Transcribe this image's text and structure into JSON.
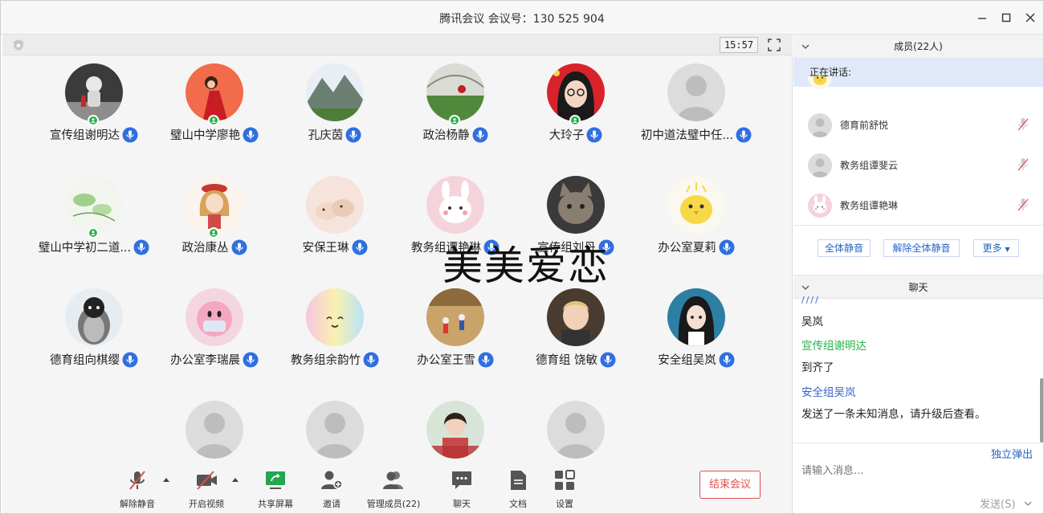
{
  "window": {
    "title": "腾讯会议 会议号：130 525 904"
  },
  "stage": {
    "timer": "15:57",
    "watermark": "美美爱恋"
  },
  "participants": [
    {
      "name": "宣传组谢明达",
      "avatar": "astronaut-photo",
      "host": true
    },
    {
      "name": "璧山中学廖艳",
      "avatar": "girl-red-dress",
      "host": true
    },
    {
      "name": "孔庆茵",
      "avatar": "mountain-landscape",
      "host": false
    },
    {
      "name": "政治杨静",
      "avatar": "greenhouse-photo",
      "host": true
    },
    {
      "name": "大玲子",
      "avatar": "cartoon-girl-glasses",
      "host": true
    },
    {
      "name": "初中道法璧中任...",
      "avatar": "default-person",
      "host": false
    },
    {
      "name": "璧山中学初二道...",
      "avatar": "green-illustration",
      "host": true
    },
    {
      "name": "政治康丛",
      "avatar": "cartoon-girl-beret",
      "host": true
    },
    {
      "name": "安保王琳",
      "avatar": "hamsters",
      "host": false
    },
    {
      "name": "教务组谭艳琳",
      "avatar": "pink-rabbit",
      "host": false
    },
    {
      "name": "宣传组刘丹",
      "avatar": "cat-photo",
      "host": false
    },
    {
      "name": "办公室夏莉",
      "avatar": "yellow-chick",
      "host": false
    },
    {
      "name": "德育组向棋缨",
      "avatar": "penguin",
      "host": false
    },
    {
      "name": "办公室李瑞晨",
      "avatar": "kirby-mask",
      "host": false
    },
    {
      "name": "教务组余韵竹",
      "avatar": "rainbow-smile",
      "host": false
    },
    {
      "name": "办公室王雪",
      "avatar": "field-people",
      "host": false
    },
    {
      "name": "德育组 饶敏",
      "avatar": "child-photo",
      "host": false
    },
    {
      "name": "安全组吴岚",
      "avatar": "anime-girl",
      "host": false
    },
    {
      "name": "",
      "avatar": "default-person",
      "host": false
    },
    {
      "name": "",
      "avatar": "default-person",
      "host": false
    },
    {
      "name": "",
      "avatar": "woman-photo",
      "host": false
    },
    {
      "name": "",
      "avatar": "default-person",
      "host": false
    }
  ],
  "toolbar": {
    "unmute": "解除静音",
    "video": "开启视频",
    "share": "共享屏幕",
    "invite": "邀请",
    "manage": "管理成员(22)",
    "chat": "聊天",
    "docs": "文档",
    "settings": "设置",
    "end": "结束会议"
  },
  "members": {
    "header": "成员(22人)",
    "speaking": "正在讲话:",
    "list": [
      {
        "name": "德育前舒悦",
        "avatar": "default-person"
      },
      {
        "name": "教务组谭斐云",
        "avatar": "default-person"
      },
      {
        "name": "教务组谭艳琳",
        "avatar": "pink-rabbit"
      }
    ],
    "mute_all": "全体静音",
    "unmute_all": "解除全体静音",
    "more": "更多"
  },
  "chat": {
    "header": "聊天",
    "messages": [
      {
        "sender": "",
        "text": "吴岚"
      },
      {
        "sender": "宣传组谢明达",
        "text": "到齐了"
      },
      {
        "sender": "安全组吴岚",
        "text": "发送了一条未知消息，请升级后查看。"
      }
    ],
    "popout": "独立弹出",
    "placeholder": "请输入消息...",
    "send": "发送(S)"
  },
  "colors": {
    "accent": "#2765c8",
    "mic": "#2f6fe0",
    "green": "#26b24a",
    "end": "#e0504b"
  }
}
